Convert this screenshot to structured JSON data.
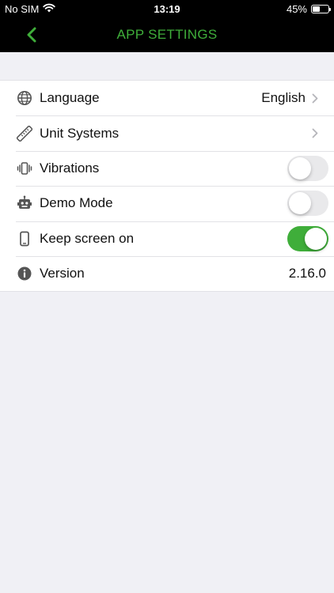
{
  "status_bar": {
    "carrier": "No SIM",
    "time": "13:19",
    "battery_percent": "45%",
    "battery_level": 0.45
  },
  "nav": {
    "title": "APP SETTINGS",
    "back_icon": "chevron-left-icon",
    "accent_color": "#3fae3a"
  },
  "settings": {
    "language": {
      "label": "Language",
      "value": "English",
      "icon": "globe-icon"
    },
    "unit_systems": {
      "label": "Unit Systems",
      "icon": "ruler-icon"
    },
    "vibrations": {
      "label": "Vibrations",
      "icon": "vibration-icon",
      "enabled": false
    },
    "demo_mode": {
      "label": "Demo Mode",
      "icon": "robot-icon",
      "enabled": false
    },
    "keep_screen_on": {
      "label": "Keep screen on",
      "icon": "phone-icon",
      "enabled": true
    },
    "version": {
      "label": "Version",
      "value": "2.16.0",
      "icon": "info-icon"
    }
  }
}
